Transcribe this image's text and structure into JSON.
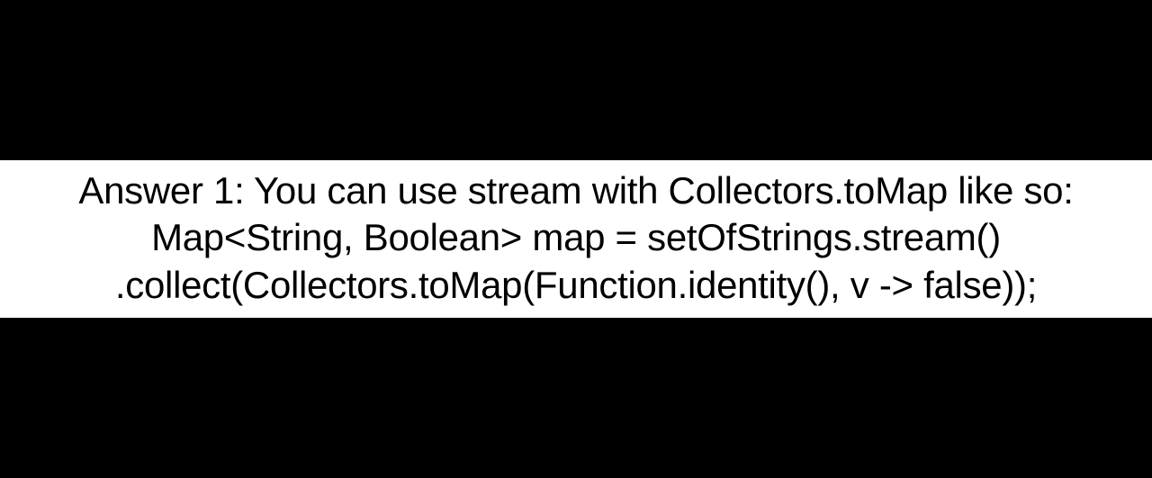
{
  "content": {
    "line1": "Answer 1: You can use stream with Collectors.toMap like so:",
    "line2": "Map<String, Boolean> map = setOfStrings.stream()",
    "line3": ".collect(Collectors.toMap(Function.identity(), v -> false));"
  }
}
